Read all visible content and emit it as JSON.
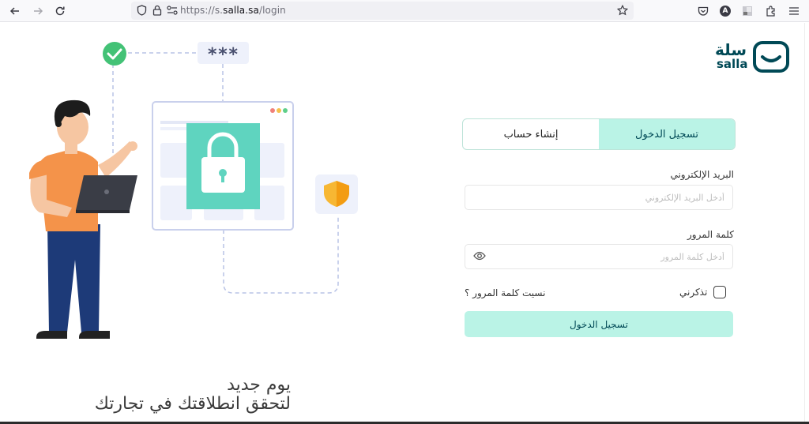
{
  "browser": {
    "url_prefix": "https://s.",
    "url_domain": "salla.sa",
    "url_path": "/login",
    "profile_initial": "A"
  },
  "illustration": {
    "password_mask": "***",
    "tagline_line1": "يوم جديد",
    "tagline_line2": "لتحقق انطلاقتك في تجارتك"
  },
  "brand": {
    "name_ar": "سلة",
    "name_en": "salla",
    "color": "#004956",
    "accent": "#baf3e6"
  },
  "tabs": [
    {
      "label": "تسجيل الدخول",
      "active": true
    },
    {
      "label": "إنشاء حساب",
      "active": false
    }
  ],
  "form": {
    "email_label": "البريد الإلكتروني",
    "email_placeholder": "أدخل البريد الإلكتروني",
    "password_label": "كلمة المرور",
    "password_placeholder": "أدخل كلمة المرور",
    "remember_label": "تذكرني",
    "forgot_label": "نسيت كلمة المرور ؟",
    "submit_label": "تسجيل الدخول"
  }
}
